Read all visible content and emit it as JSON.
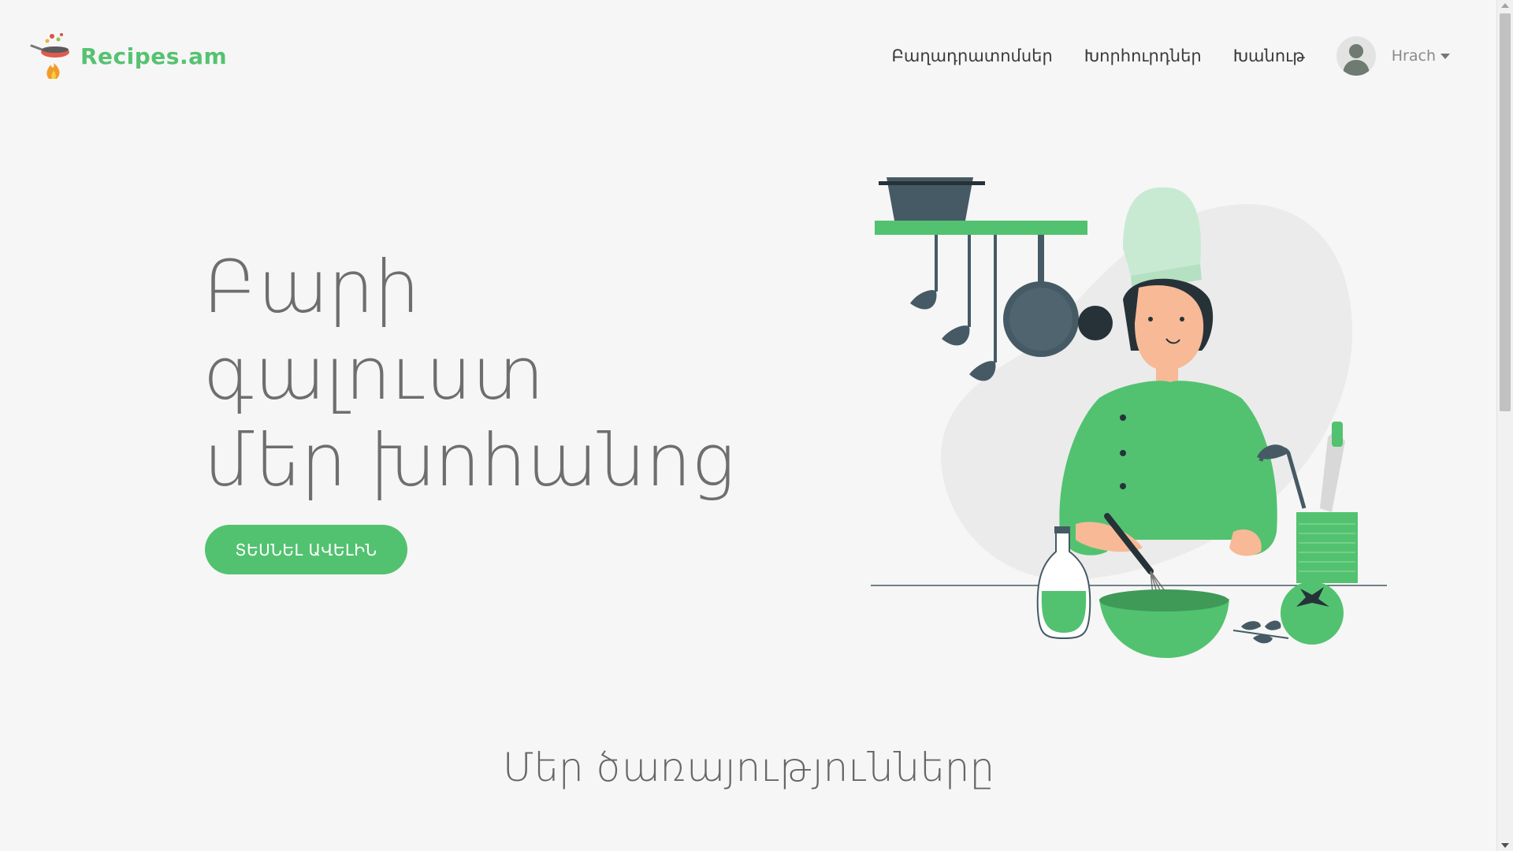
{
  "brand": {
    "name": "Recipes.am",
    "icon": "frying-pan-flame-icon",
    "color": "#56c271"
  },
  "nav": {
    "items": [
      {
        "label": "Բաղադրատոմսեր"
      },
      {
        "label": "Խորհուրդներ"
      },
      {
        "label": "Խանութ"
      }
    ],
    "user": {
      "name": "Hrach",
      "avatar_icon": "user-avatar-icon"
    }
  },
  "hero": {
    "title_lines": [
      "Բարի",
      "գալուստ",
      "մեր խոհանոց"
    ],
    "cta_label": "ՏԵՍՆԵԼ ԱՎԵԼԻՆ",
    "accent": "#52c270",
    "illustration": "chef-cooking-illustration"
  },
  "services": {
    "title": "Մեր ծառայությունները"
  }
}
